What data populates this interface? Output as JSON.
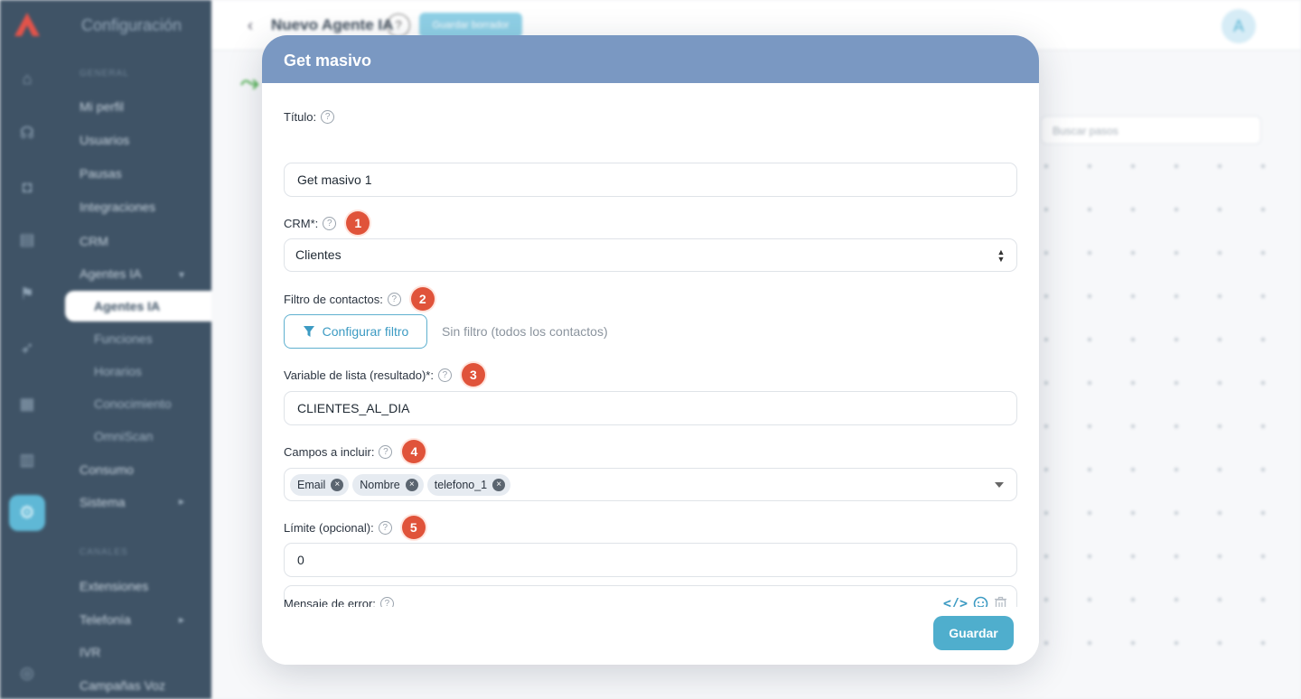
{
  "background": {
    "menu_header": "Configuración",
    "menu_section_general": "GENERAL",
    "menu_section_channels": "CANALES",
    "menu_items": [
      "Mi perfil",
      "Usuarios",
      "Pausas",
      "Integraciones",
      "CRM",
      "Agentes IA"
    ],
    "menu_subitems": [
      "Agentes IA",
      "Funciones",
      "Horarios",
      "Conocimiento",
      "OmniScan"
    ],
    "menu_items_after": [
      "Consumo",
      "Sistema"
    ],
    "menu_items_channels": [
      "Extensiones",
      "Telefonía",
      "IVR",
      "Campañas Voz"
    ],
    "page_title": "Nuevo Agente IA",
    "header_pill": "Guardar borrador",
    "avatar_letter": "A",
    "canvas_search_placeholder": "Buscar pasos"
  },
  "modal": {
    "title": "Get masivo",
    "fields": {
      "title": {
        "label": "Título:",
        "value": "Get masivo 1"
      },
      "crm": {
        "label": "CRM*:",
        "value": "Clientes",
        "badge": "1"
      },
      "contact_filter": {
        "label": "Filtro de contactos:",
        "badge": "2",
        "button": "Configurar filtro",
        "status": "Sin filtro (todos los contactos)"
      },
      "list_variable": {
        "label": "Variable de lista (resultado)*:",
        "badge": "3",
        "value": "CLIENTES_AL_DIA"
      },
      "fields_include": {
        "label": "Campos a incluir:",
        "badge": "4",
        "tags": [
          "Email",
          "Nombre",
          "telefono_1"
        ]
      },
      "limit": {
        "label": "Límite (opcional):",
        "badge": "5",
        "value": "0"
      },
      "error_message": {
        "label": "Mensaje de error:",
        "value": ""
      }
    },
    "help_glyph": "?",
    "save_button": "Guardar"
  }
}
